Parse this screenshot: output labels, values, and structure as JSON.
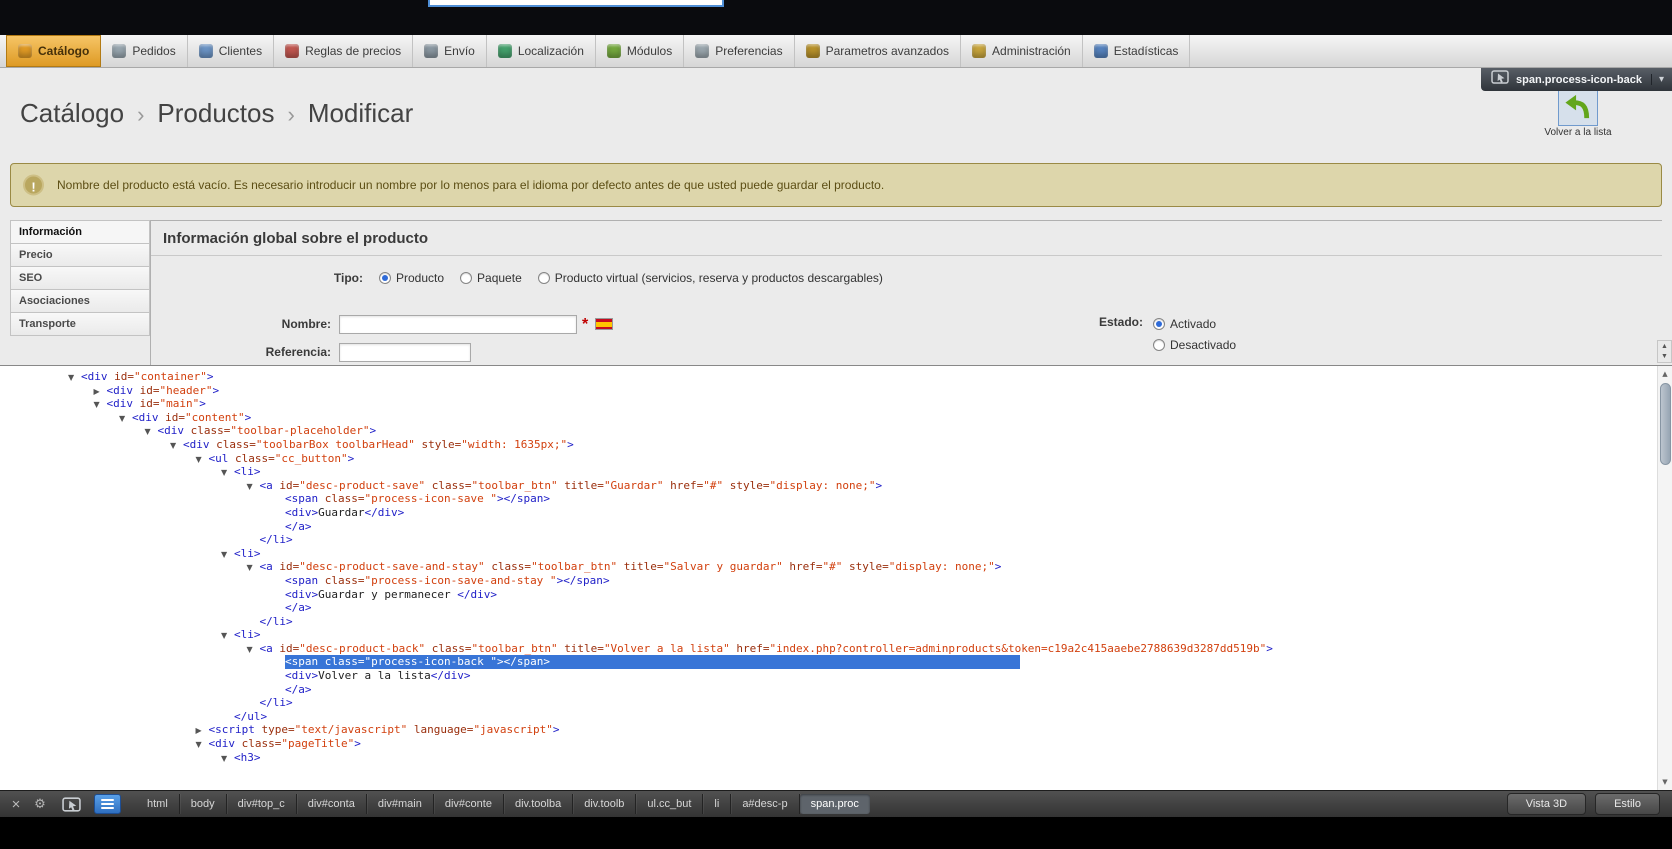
{
  "inspector_chip": {
    "label": "span.process-icon-back"
  },
  "tabs": [
    {
      "label": "Catálogo",
      "icon": "catalog-icon",
      "icon_color": "#e09a25",
      "active": true
    },
    {
      "label": "Pedidos",
      "icon": "orders-icon",
      "icon_color": "#97a5ae",
      "active": false
    },
    {
      "label": "Clientes",
      "icon": "customers-icon",
      "icon_color": "#6b93c4",
      "active": false
    },
    {
      "label": "Reglas de precios",
      "icon": "price-rules-icon",
      "icon_color": "#c0564f",
      "active": false
    },
    {
      "label": "Envío",
      "icon": "shipping-icon",
      "icon_color": "#8a97a1",
      "active": false
    },
    {
      "label": "Localización",
      "icon": "localization-icon",
      "icon_color": "#44a06c",
      "active": false
    },
    {
      "label": "Módulos",
      "icon": "modules-icon",
      "icon_color": "#74a83e",
      "active": false
    },
    {
      "label": "Preferencias",
      "icon": "preferences-icon",
      "icon_color": "#9aa6ad",
      "active": false
    },
    {
      "label": "Parametros avanzados",
      "icon": "advanced-parameters-icon",
      "icon_color": "#b7912a",
      "active": false
    },
    {
      "label": "Administración",
      "icon": "administration-icon",
      "icon_color": "#c7a43c",
      "active": false
    },
    {
      "label": "Estadísticas",
      "icon": "stats-icon",
      "icon_color": "#5582bd",
      "active": false
    }
  ],
  "breadcrumb": {
    "items": [
      "Catálogo",
      "Productos",
      "Modificar"
    ],
    "separator": "›"
  },
  "back_button": {
    "label": "Volver a la lista"
  },
  "warning": {
    "text": "Nombre del producto está vacío. Es necesario introducir un nombre por lo menos para el idioma por defecto antes de que usted puede guardar el producto."
  },
  "product_tabs": [
    "Información",
    "Precio",
    "SEO",
    "Asociaciones",
    "Transporte"
  ],
  "form": {
    "section_title": "Información global sobre el producto",
    "tipo_label": "Tipo:",
    "tipo_options": [
      {
        "label": "Producto",
        "selected": true
      },
      {
        "label": "Paquete",
        "selected": false
      },
      {
        "label": "Producto virtual (servicios, reserva y productos descargables)",
        "selected": false
      }
    ],
    "nombre_label": "Nombre:",
    "nombre_value": "",
    "required_mark": "*",
    "referencia_label": "Referencia:",
    "estado_label": "Estado:",
    "estado_options": [
      {
        "label": "Activado",
        "selected": true
      },
      {
        "label": "Desactivado",
        "selected": false
      }
    ]
  },
  "firebug": {
    "tree_lines": [
      {
        "i": 0,
        "tw": "v",
        "s": "<div id=\"container\">"
      },
      {
        "i": 1,
        "tw": ">",
        "s": "<div id=\"header\">"
      },
      {
        "i": 1,
        "tw": "v",
        "s": "<div id=\"main\">"
      },
      {
        "i": 2,
        "tw": "v",
        "s": "<div id=\"content\">"
      },
      {
        "i": 3,
        "tw": "v",
        "s": "<div class=\"toolbar-placeholder\">"
      },
      {
        "i": 4,
        "tw": "v",
        "s": "<div class=\"toolbarBox toolbarHead\" style=\"width: 1635px;\">"
      },
      {
        "i": 5,
        "tw": "v",
        "s": "<ul class=\"cc_button\">"
      },
      {
        "i": 6,
        "tw": "v",
        "s": "<li>"
      },
      {
        "i": 7,
        "tw": "v",
        "s": "<a id=\"desc-product-save\" class=\"toolbar_btn\" title=\"Guardar\" href=\"#\" style=\"display: none;\">"
      },
      {
        "i": 8,
        "tw": "",
        "s": "<span class=\"process-icon-save \"></span>"
      },
      {
        "i": 8,
        "tw": "",
        "s": "<div>Guardar</div>"
      },
      {
        "i": 8,
        "tw": "",
        "s": "</a>"
      },
      {
        "i": 7,
        "tw": "",
        "s": "</li>"
      },
      {
        "i": 6,
        "tw": "v",
        "s": "<li>"
      },
      {
        "i": 7,
        "tw": "v",
        "s": "<a id=\"desc-product-save-and-stay\" class=\"toolbar_btn\" title=\"Salvar y guardar\" href=\"#\" style=\"display: none;\">"
      },
      {
        "i": 8,
        "tw": "",
        "s": "<span class=\"process-icon-save-and-stay \"></span>"
      },
      {
        "i": 8,
        "tw": "",
        "s": "<div>Guardar y permanecer </div>"
      },
      {
        "i": 8,
        "tw": "",
        "s": "</a>"
      },
      {
        "i": 7,
        "tw": "",
        "s": "</li>"
      },
      {
        "i": 6,
        "tw": "v",
        "s": "<li>"
      },
      {
        "i": 7,
        "tw": "v",
        "s": "<a id=\"desc-product-back\" class=\"toolbar_btn\" title=\"Volver a la lista\" href=\"index.php?controller=adminproducts&token=c19a2c415aaebe2788639d3287dd519b\">"
      },
      {
        "i": 8,
        "tw": "",
        "s": "<span class=\"process-icon-back \"></span>",
        "hl": true
      },
      {
        "i": 8,
        "tw": "",
        "s": "<div>Volver a la lista</div>"
      },
      {
        "i": 8,
        "tw": "",
        "s": "</a>"
      },
      {
        "i": 7,
        "tw": "",
        "s": "</li>"
      },
      {
        "i": 6,
        "tw": "",
        "s": "</ul>"
      },
      {
        "i": 5,
        "tw": ">",
        "s": "<script type=\"text/javascript\" language=\"javascript\">"
      },
      {
        "i": 5,
        "tw": "v",
        "s": "<div class=\"pageTitle\">"
      },
      {
        "i": 6,
        "tw": "v",
        "s": "<h3>"
      }
    ],
    "statusbar": {
      "path": [
        "html",
        "body",
        "div#top_c",
        "div#conta",
        "div#main",
        "div#conte",
        "div.toolba",
        "div.toolb",
        "ul.cc_but",
        "li",
        "a#desc-p",
        "span.proc"
      ],
      "buttons": [
        "Vista 3D",
        "Estilo"
      ]
    }
  },
  "colors": {
    "active_tab": "#de9a24",
    "selection_blue": "#3875d7",
    "tag_blue": "#2121c8",
    "attr_name": "#9a2e0c",
    "attr_value": "#d2400e",
    "warning_bg": "#ddd6ab",
    "warning_border": "#9a8a45",
    "back_arrow_green": "#63a61b"
  }
}
